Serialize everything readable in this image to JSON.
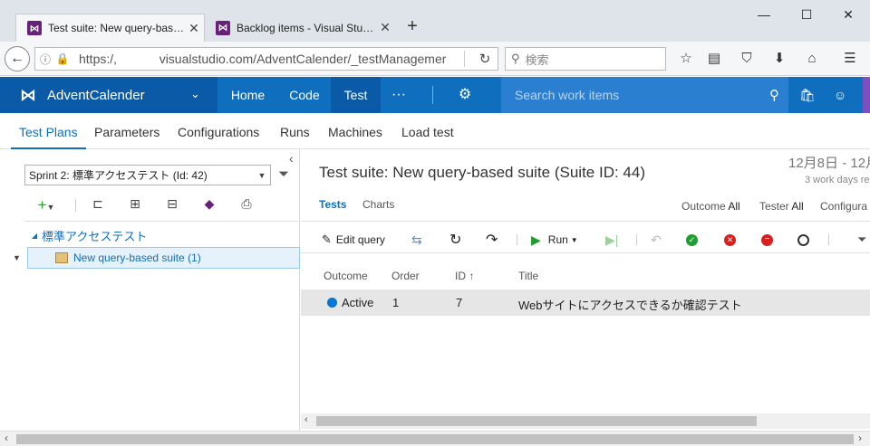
{
  "browser": {
    "tabs": [
      {
        "title": "Test suite: New query-bas…",
        "active": true
      },
      {
        "title": "Backlog items - Visual Stu…",
        "active": false
      }
    ],
    "new_tab": "+",
    "url": "https:/,            visualstudio.com/AdventCalender/_testManagemer",
    "search_placeholder": "検索",
    "window": {
      "minimize": "—",
      "maximize": "☐",
      "close": "✕"
    }
  },
  "app": {
    "project": "AdventCalender",
    "nav": [
      "Home",
      "Code",
      "Test"
    ],
    "more": "···",
    "search_placeholder": "Search work items"
  },
  "hub_tabs": [
    "Test Plans",
    "Parameters",
    "Configurations",
    "Runs",
    "Machines",
    "Load test"
  ],
  "left": {
    "collapse": "‹",
    "plan": "Sprint 2: 標準アクセステスト (Id: 42)",
    "tree": {
      "root": "標準アクセステスト",
      "child": "New query-based suite (1)"
    }
  },
  "right": {
    "title": "Test suite: New query-based suite (Suite ID: 44)",
    "date": "12月8日 - 12月",
    "workdays": "3 work days re",
    "subtabs": [
      "Tests",
      "Charts"
    ],
    "filters": {
      "outcome_label": "Outcome",
      "outcome_value": "All",
      "tester_label": "Tester",
      "tester_value": "All",
      "config_label": "Configura"
    },
    "toolbar": {
      "edit_query": "Edit query",
      "run": "Run"
    },
    "columns": {
      "outcome": "Outcome",
      "order": "Order",
      "id": "ID",
      "title": "Title"
    },
    "rows": [
      {
        "outcome": "Active",
        "order": "1",
        "id": "7",
        "title": "Webサイトにアクセスできるか確認テスト"
      }
    ]
  },
  "colors": {
    "accent": "#106ebe",
    "header": "#0a5aa8",
    "vs_purple": "#68217a",
    "active_dot": "#0078d7"
  }
}
